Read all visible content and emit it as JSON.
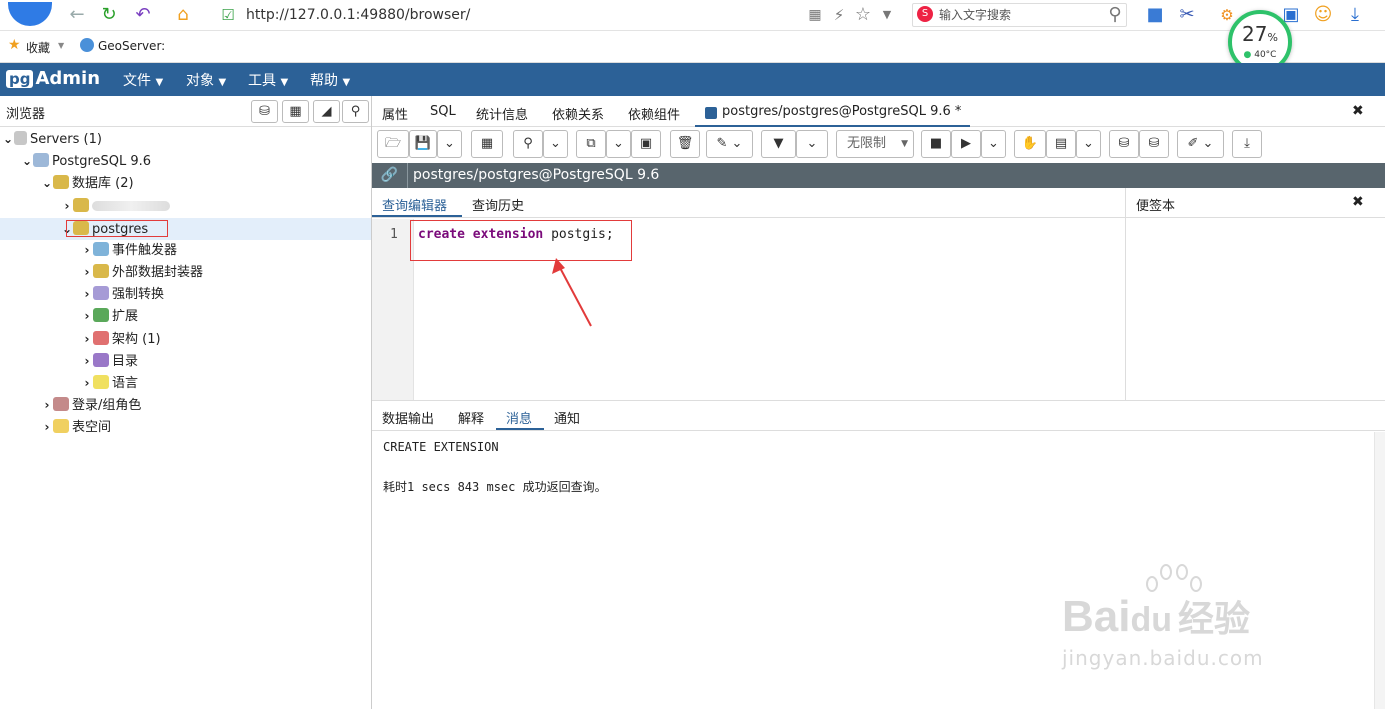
{
  "browser": {
    "url": "http://127.0.0.1:49880/browser/",
    "search_placeholder": "输入文字搜索",
    "bookmarks": [
      "收藏",
      "GeoServer:"
    ],
    "cpu_badge": {
      "percent": "27",
      "unit": "%",
      "temp": "40°C"
    }
  },
  "app": {
    "logo_pg": "pg",
    "logo_text": "Admin",
    "menu": [
      "文件",
      "对象",
      "工具",
      "帮助"
    ]
  },
  "left_panel": {
    "title": "浏览器",
    "tree": [
      {
        "label": "Servers (1)",
        "level": 0,
        "expanded": true
      },
      {
        "label": "PostgreSQL 9.6",
        "level": 1,
        "expanded": true
      },
      {
        "label": "数据库 (2)",
        "level": 2,
        "expanded": true
      },
      {
        "label": "",
        "level": 3,
        "expanded": false
      },
      {
        "label": "postgres",
        "level": 3,
        "expanded": true,
        "selected": true
      },
      {
        "label": "事件触发器",
        "level": 4,
        "expanded": false
      },
      {
        "label": "外部数据封装器",
        "level": 4,
        "expanded": false
      },
      {
        "label": "强制转换",
        "level": 4,
        "expanded": false
      },
      {
        "label": "扩展",
        "level": 4,
        "expanded": false
      },
      {
        "label": "架构 (1)",
        "level": 4,
        "expanded": false
      },
      {
        "label": "目录",
        "level": 4,
        "expanded": false
      },
      {
        "label": "语言",
        "level": 4,
        "expanded": false
      },
      {
        "label": "登录/组角色",
        "level": 2,
        "expanded": false
      },
      {
        "label": "表空间",
        "level": 2,
        "expanded": false
      }
    ]
  },
  "right_tabs": [
    "属性",
    "SQL",
    "统计信息",
    "依赖关系",
    "依赖组件",
    "postgres/postgres@PostgreSQL 9.6 *"
  ],
  "toolbar": {
    "limit_label": "无限制"
  },
  "connection": "postgres/postgres@PostgreSQL 9.6",
  "editor": {
    "tabs": [
      "查询编辑器",
      "查询历史"
    ],
    "notes_title": "便签本",
    "line_number": "1",
    "code_keyword1": "create",
    "code_keyword2": "extension",
    "code_rest": "postgis;"
  },
  "results": {
    "tabs": [
      "数据输出",
      "解释",
      "消息",
      "通知"
    ],
    "active_tab": "消息",
    "message_line1": "CREATE EXTENSION",
    "message_line2": "耗时1 secs 843 msec 成功返回查询。"
  },
  "watermark": {
    "line1": "Bai",
    "line1b": "du",
    "line1c": "经验",
    "line2": "jingyan.baidu.com"
  },
  "colors": {
    "header": "#2c6197",
    "conn_bar": "#58656d",
    "active_tab": "#2c6197",
    "highlight_box": "#e23b3b",
    "keyword": "#7a0a7a"
  }
}
